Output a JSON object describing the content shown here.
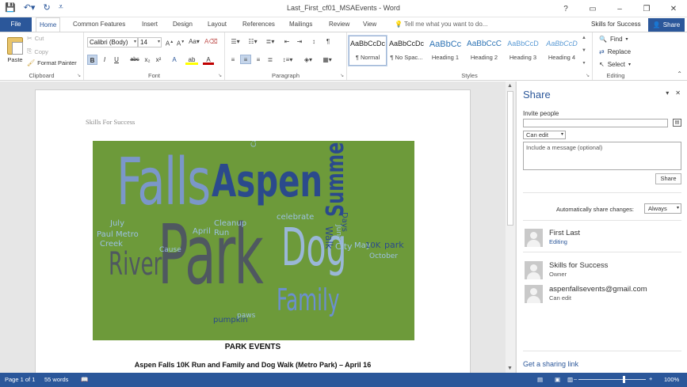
{
  "window": {
    "title": "Last_First_cf01_MSAEvents - Word",
    "controls": [
      "?",
      "▭",
      "–",
      "❐",
      "✕"
    ]
  },
  "quick_access": {
    "icons": [
      "save-icon",
      "undo-icon",
      "redo-icon",
      "customize-icon"
    ]
  },
  "tabs": [
    {
      "label": "File"
    },
    {
      "label": "Home"
    },
    {
      "label": "Common Features"
    },
    {
      "label": "Insert"
    },
    {
      "label": "Design"
    },
    {
      "label": "Layout"
    },
    {
      "label": "References"
    },
    {
      "label": "Mailings"
    },
    {
      "label": "Review"
    },
    {
      "label": "View"
    }
  ],
  "tell_me": "Tell me what you want to do...",
  "account": "Skills for Success",
  "share_button": "Share",
  "clipboard": {
    "paste": "Paste",
    "cut": "Cut",
    "copy": "Copy",
    "format_painter": "Format Painter",
    "label": "Clipboard"
  },
  "font": {
    "family": "Calibri (Body)",
    "size": "14",
    "label": "Font",
    "buttons": [
      "B",
      "I",
      "U",
      "abc",
      "x₂",
      "x²",
      "A",
      "ab",
      "A"
    ]
  },
  "paragraph": {
    "label": "Paragraph"
  },
  "styles": {
    "label": "Styles",
    "items": [
      {
        "sample": "AaBbCcDc",
        "name": "¶ Normal"
      },
      {
        "sample": "AaBbCcDc",
        "name": "¶ No Spac..."
      },
      {
        "sample": "AaBbCc",
        "name": "Heading 1"
      },
      {
        "sample": "AaBbCcC",
        "name": "Heading 2"
      },
      {
        "sample": "AaBbCcD",
        "name": "Heading 3"
      },
      {
        "sample": "AaBbCcD",
        "name": "Heading 4"
      }
    ]
  },
  "editing": {
    "label": "Editing",
    "find": "Find",
    "replace": "Replace",
    "select": "Select"
  },
  "document": {
    "header": "Skills For Success",
    "heading": "PARK EVENTS",
    "subheading": "Aspen Falls 10K Run and Family and Dog Walk (Metro Park) – April 16",
    "wordcloud": [
      {
        "text": "Falls"
      },
      {
        "text": "Aspen"
      },
      {
        "text": "Summer"
      },
      {
        "text": "Park"
      },
      {
        "text": "Dog"
      },
      {
        "text": "Family"
      },
      {
        "text": "River"
      },
      {
        "text": "celebrate"
      },
      {
        "text": "Walk"
      },
      {
        "text": "Days"
      },
      {
        "text": "June"
      },
      {
        "text": "City"
      },
      {
        "text": "May"
      },
      {
        "text": "10K"
      },
      {
        "text": "park"
      },
      {
        "text": "October"
      },
      {
        "text": "Cleanup"
      },
      {
        "text": "Run"
      },
      {
        "text": "April"
      },
      {
        "text": "July"
      },
      {
        "text": "Paul Metro"
      },
      {
        "text": "Creek"
      },
      {
        "text": "Cause"
      },
      {
        "text": "pumpkin"
      },
      {
        "text": "paws"
      },
      {
        "text": "Carving"
      }
    ]
  },
  "share_pane": {
    "title": "Share",
    "invite_label": "Invite people",
    "permission": "Can edit",
    "message_placeholder": "Include a message (optional)",
    "share_button": "Share",
    "auto_share_label": "Automatically share changes:",
    "auto_share_value": "Always",
    "people": [
      {
        "name": "First Last",
        "role": "Editing"
      },
      {
        "name": "Skills for Success",
        "role": "Owner"
      },
      {
        "name": "aspenfallsevents@gmail.com",
        "role": "Can edit"
      }
    ],
    "get_link": "Get a sharing link"
  },
  "status": {
    "page": "Page 1 of 1",
    "words": "55 words",
    "zoom": "100%"
  }
}
